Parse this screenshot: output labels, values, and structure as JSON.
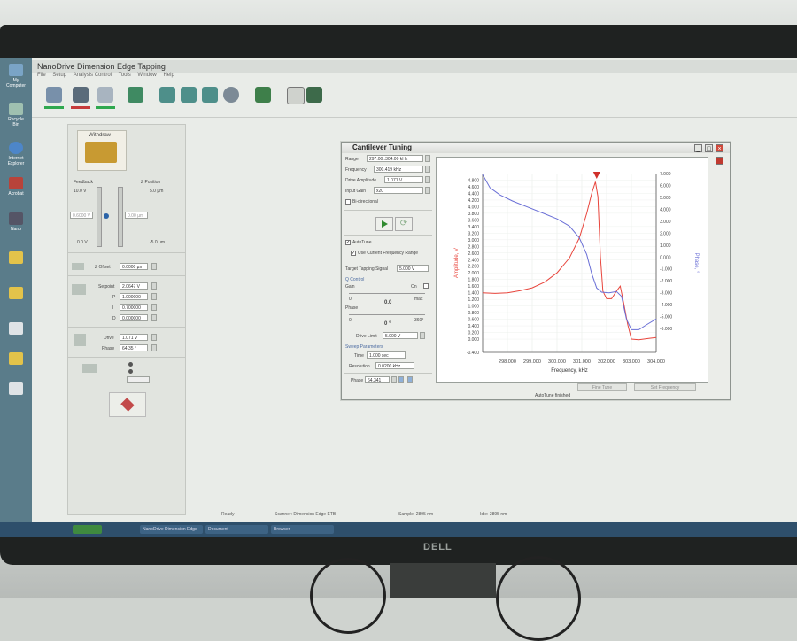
{
  "app": {
    "title": "NanoDrive Dimension Edge Tapping",
    "menu": [
      "File",
      "Setup",
      "Analysis Control",
      "Tools",
      "Window",
      "Help"
    ]
  },
  "desktop": {
    "icons": [
      "My Computer",
      "Recycle Bin",
      "Internet Explorer",
      "Acrobat",
      "Nano",
      "",
      "",
      "",
      "",
      ""
    ]
  },
  "left_panel": {
    "withdraw_label": "Withdraw",
    "feedback_label": "Feedback",
    "zposition_label": "Z Position",
    "feedback_top": "10.0 V",
    "feedback_bottom": "0.0 V",
    "zpos_top": "5.0 µm",
    "zpos_bottom": "-5.0 µm",
    "feedback_value": "0.6000 V",
    "zpos_value": "0.00 µm",
    "zoffset_label": "Z Offset",
    "zoffset_value": "0.0000 µm",
    "setpoint_label": "Setpoint",
    "setpoint_value": "2.0647 V",
    "p_label": "P",
    "p_value": "1.000000",
    "i_label": "I",
    "i_value": "0.700000",
    "d_label": "D",
    "d_value": "0.000000",
    "drive_label": "Drive",
    "drive_value": "1.071 V",
    "phase_label": "Phase",
    "phase_value": "64.35 °"
  },
  "dialog": {
    "title": "Cantilever Tuning",
    "range_label": "Range",
    "range_value": "297.00..304.00 kHz",
    "frequency_label": "Frequency",
    "frequency_value": "300.419 kHz",
    "drive_amp_label": "Drive Amplitude",
    "drive_amp_value": "1.071 V",
    "input_gain_label": "Input Gain",
    "input_gain_value": "x20",
    "bidirectional_label": "Bi-directional",
    "autotune_label": "AutoTune",
    "use_current_label": "Use Current Frequency Range",
    "target_label": "Target Tapping Signal",
    "target_value": "5.000 V",
    "q_control_label": "Q Control",
    "gain_label": "Gain",
    "on_label": "On",
    "q_zero": "0",
    "q_max": "max",
    "q_value": "0.0",
    "phase_label": "Phase",
    "phase_zero": "0",
    "phase_max": "360°",
    "phase_value": "0 °",
    "drive_limit_label": "Drive Limit",
    "drive_limit_value": "5.000 V",
    "sweep_label": "Sweep Parameters",
    "time_label": "Time",
    "time_value": "1.000 sec",
    "resolution_label": "Resolution",
    "resolution_value": "0.0200 kHz",
    "phase_bottom_label": "Phase",
    "phase_bottom_value": "64.341",
    "btn_fine_tune": "Fine Tune",
    "btn_set_freq": "Set Frequency",
    "status": "AutoTune finished"
  },
  "statusbar": {
    "left": "Ready",
    "mid": "Scanner: Dimension Edge ETB",
    "right": "Sample: 2895 nm",
    "far": "Idle: 2895 nm"
  },
  "taskbar": {
    "items": [
      "NanoDrive Dimension Edge",
      "Document",
      "Browser"
    ]
  },
  "colors": {
    "amplitude": "#e8453c",
    "phase": "#6a6fd6"
  },
  "chart_data": {
    "type": "line",
    "title": "",
    "xlabel": "Frequency, kHz",
    "ylabel": "Amplitude, V",
    "y2label": "Phase, °",
    "xlim": [
      297.0,
      304.0
    ],
    "ylim": [
      -0.4,
      5.0
    ],
    "y2lim": [
      -8.0,
      7.0
    ],
    "x_ticks": [
      "298.000",
      "299.000",
      "300.000",
      "301.000",
      "302.000",
      "303.000",
      "304.000"
    ],
    "y_ticks": [
      "4.800",
      "4.600",
      "4.400",
      "4.200",
      "4.000",
      "3.800",
      "3.600",
      "3.400",
      "3.200",
      "3.000",
      "2.800",
      "2.600",
      "2.400",
      "2.200",
      "2.000",
      "1.800",
      "1.600",
      "1.400",
      "1.200",
      "1.000",
      "0.800",
      "0.600",
      "0.400",
      "0.200",
      "0.000",
      "-0.400"
    ],
    "y2_ticks": [
      "7.000",
      "6.000",
      "5.000",
      "4.000",
      "3.000",
      "2.000",
      "1.000",
      "0.000",
      "-1.000",
      "-2.000",
      "-3.000",
      "-4.000",
      "-5.000",
      "-6.000"
    ],
    "marker_x": 301.6,
    "series": [
      {
        "name": "Amplitude",
        "axis": "left",
        "points": [
          [
            297.0,
            1.4
          ],
          [
            297.5,
            1.38
          ],
          [
            298.0,
            1.4
          ],
          [
            298.5,
            1.46
          ],
          [
            299.0,
            1.55
          ],
          [
            299.5,
            1.72
          ],
          [
            300.0,
            2.0
          ],
          [
            300.5,
            2.45
          ],
          [
            300.9,
            3.05
          ],
          [
            301.2,
            3.8
          ],
          [
            301.4,
            4.4
          ],
          [
            301.55,
            4.75
          ],
          [
            301.65,
            4.3
          ],
          [
            301.75,
            2.5
          ],
          [
            301.85,
            1.45
          ],
          [
            302.0,
            1.22
          ],
          [
            302.2,
            1.22
          ],
          [
            302.4,
            1.45
          ],
          [
            302.55,
            1.6
          ],
          [
            302.7,
            1.05
          ],
          [
            302.85,
            0.45
          ],
          [
            303.0,
            0.0
          ],
          [
            303.3,
            -0.02
          ],
          [
            303.7,
            0.02
          ],
          [
            304.0,
            0.05
          ]
        ]
      },
      {
        "name": "Phase",
        "axis": "right",
        "points": [
          [
            297.0,
            6.9
          ],
          [
            297.3,
            5.8
          ],
          [
            297.7,
            5.2
          ],
          [
            298.2,
            4.7
          ],
          [
            298.8,
            4.2
          ],
          [
            299.4,
            3.7
          ],
          [
            300.0,
            3.2
          ],
          [
            300.5,
            2.6
          ],
          [
            300.9,
            1.6
          ],
          [
            301.2,
            0.2
          ],
          [
            301.4,
            -1.4
          ],
          [
            301.6,
            -2.6
          ],
          [
            301.8,
            -2.95
          ],
          [
            302.1,
            -3.0
          ],
          [
            302.4,
            -2.9
          ],
          [
            302.6,
            -3.3
          ],
          [
            302.8,
            -5.2
          ],
          [
            303.0,
            -6.1
          ],
          [
            303.3,
            -6.1
          ],
          [
            303.6,
            -5.7
          ],
          [
            304.0,
            -5.2
          ]
        ]
      }
    ]
  }
}
